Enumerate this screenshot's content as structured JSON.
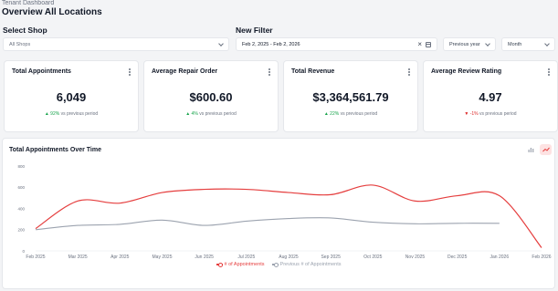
{
  "breadcrumb": "Tenant Dashboard",
  "page_title": "Overview All Locations",
  "shop_filter": {
    "label": "Select Shop",
    "value": "All Shops"
  },
  "date_filter": {
    "label": "New Filter",
    "value": "Feb 2, 2025 - Feb 2, 2026",
    "comparison": "Previous year",
    "granularity": "Month"
  },
  "colors": {
    "current": "#e53e3e",
    "previous": "#9ca3af",
    "up": "#16a34a",
    "down": "#dc2626"
  },
  "kpis": [
    {
      "title": "Total Appointments",
      "value": "6,049",
      "change": "▲ 92%",
      "change_dir": "up",
      "suffix": "vs previous period"
    },
    {
      "title": "Average Repair Order",
      "value": "$600.60",
      "change": "▲ 4%",
      "change_dir": "up",
      "suffix": "vs previous period"
    },
    {
      "title": "Total Revenue",
      "value": "$3,364,561.79",
      "change": "▲ 22%",
      "change_dir": "up",
      "suffix": "vs previous period"
    },
    {
      "title": "Average Review Rating",
      "value": "4.97",
      "change": "▼ -1%",
      "change_dir": "down",
      "suffix": "vs previous period"
    }
  ],
  "chart": {
    "title": "Total Appointments Over Time",
    "toggles": [
      "bar-chart-icon",
      "line-chart-icon"
    ]
  },
  "chart_data": {
    "type": "line",
    "title": "Total Appointments Over Time",
    "categories": [
      "Feb 2025",
      "Mar 2025",
      "Apr 2025",
      "May 2025",
      "Jun 2025",
      "Jul 2025",
      "Aug 2025",
      "Sep 2025",
      "Oct 2025",
      "Nov 2025",
      "Dec 2025",
      "Jan 2026",
      "Feb 2026"
    ],
    "ylim": [
      0,
      800
    ],
    "yticks": [
      0,
      200,
      400,
      600,
      800
    ],
    "series": [
      {
        "name": "# of Appointments",
        "values": [
          210,
          470,
          450,
          550,
          580,
          580,
          550,
          530,
          620,
          470,
          520,
          520,
          30
        ]
      },
      {
        "name": "Previous # of Appointments",
        "values": [
          200,
          240,
          250,
          290,
          240,
          280,
          305,
          310,
          270,
          255,
          260,
          260,
          null
        ]
      }
    ],
    "legend": "bottom",
    "grid": false
  }
}
